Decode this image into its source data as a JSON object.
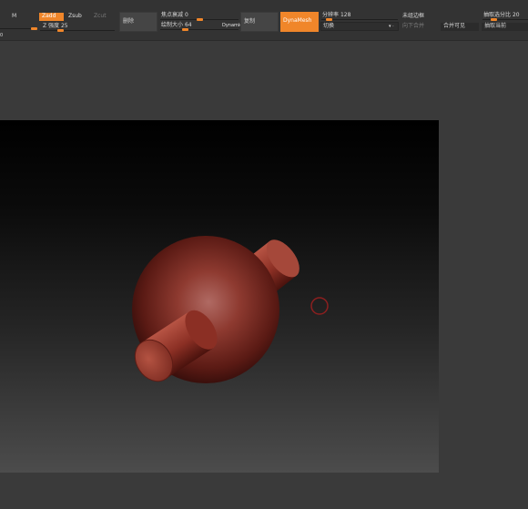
{
  "toolbar": {
    "m_label": "M",
    "zadd_label": "Zadd",
    "zsub_label": "Zsub",
    "zcut_label": "Zcut",
    "z_intensity_label": "Z 强度",
    "z_intensity_value": "25",
    "z_intensity_level": 0.25,
    "delete_label": "删除",
    "focal_shift_label": "焦点衰减",
    "focal_shift_value": "0",
    "focal_shift_level": 0.5,
    "draw_size_label": "绘制大小",
    "draw_size_value": "64",
    "draw_size_level": 0.3,
    "dynamic_label": "Dynamic",
    "copy_label": "复制",
    "dynamesh_label": "DynaMesh",
    "resolution_label": "分辨率",
    "resolution_value": "128",
    "resolution_level": 0.06,
    "preset_label": "切换",
    "merge_label": "合并可见",
    "groups_split_label": "未组边框",
    "merge_down_label": "向下合并",
    "subdiv_label": "抽取选分比",
    "subdiv_value": "20",
    "subdiv_level": 0.2,
    "extract_current_label": "抽取当前"
  },
  "colors": {
    "accent": "#f0862a",
    "mesh_red": "#8a2a22",
    "toolbar_bg": "#333333",
    "canvas_bg": "#3a3a3a"
  },
  "canvas": {
    "model": "sphere-with-cylinder",
    "brush_cursor": "red-circle"
  }
}
